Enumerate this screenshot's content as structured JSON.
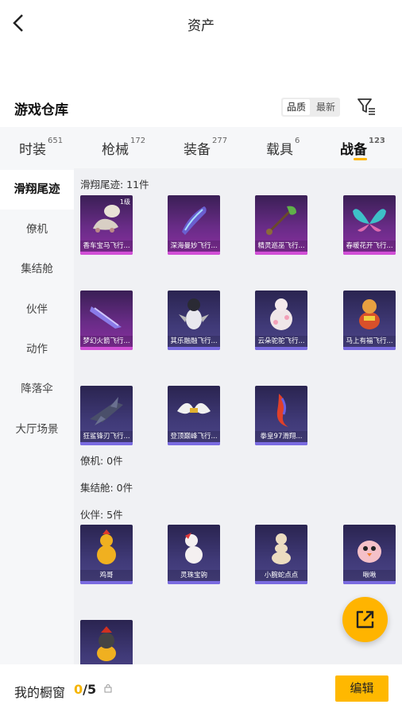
{
  "header": {
    "title": "资产"
  },
  "warehouse": {
    "title": "游戏仓库",
    "sort_options": [
      "品质",
      "最新"
    ]
  },
  "tabs": [
    {
      "label": "时装",
      "count": "651"
    },
    {
      "label": "枪械",
      "count": "172"
    },
    {
      "label": "装备",
      "count": "277"
    },
    {
      "label": "载具",
      "count": "6"
    },
    {
      "label": "战备",
      "count": "123"
    }
  ],
  "sidebar": {
    "items": [
      "滑翔尾迹",
      "僚机",
      "集结舱",
      "伙伴",
      "动作",
      "降落伞",
      "大厅场景"
    ]
  },
  "groups": {
    "trail": "滑翔尾迹: 11件",
    "wingman": "僚机: 0件",
    "pod": "集结舱: 0件",
    "partner": "伙伴: 5件"
  },
  "items": [
    {
      "name": "香车宝马飞行...",
      "level": "1级"
    },
    {
      "name": "深海曼妙飞行..."
    },
    {
      "name": "精灵巡巫飞行..."
    },
    {
      "name": "春暖花开飞行..."
    },
    {
      "name": "梦幻火箭飞行..."
    },
    {
      "name": "其乐融融飞行..."
    },
    {
      "name": "云朵驼驼飞行..."
    },
    {
      "name": "马上有福飞行..."
    },
    {
      "name": "狂鲨锋刃飞行..."
    },
    {
      "name": "登顶巅峰飞行..."
    },
    {
      "name": "拳皇97滑翔..."
    },
    {
      "name": "鸡哥"
    },
    {
      "name": "灵珠宝驹"
    },
    {
      "name": "小腕蛇点点"
    },
    {
      "name": "啾啾"
    },
    {
      "name": ""
    }
  ],
  "bottom": {
    "showcase_label": "我的橱窗",
    "current": "0",
    "total": "/5",
    "edit_label": "编辑"
  },
  "colors": {
    "accent": "#ffb400",
    "rare_purple": "#d14fd6",
    "epic_blue": "#7a6be0"
  }
}
